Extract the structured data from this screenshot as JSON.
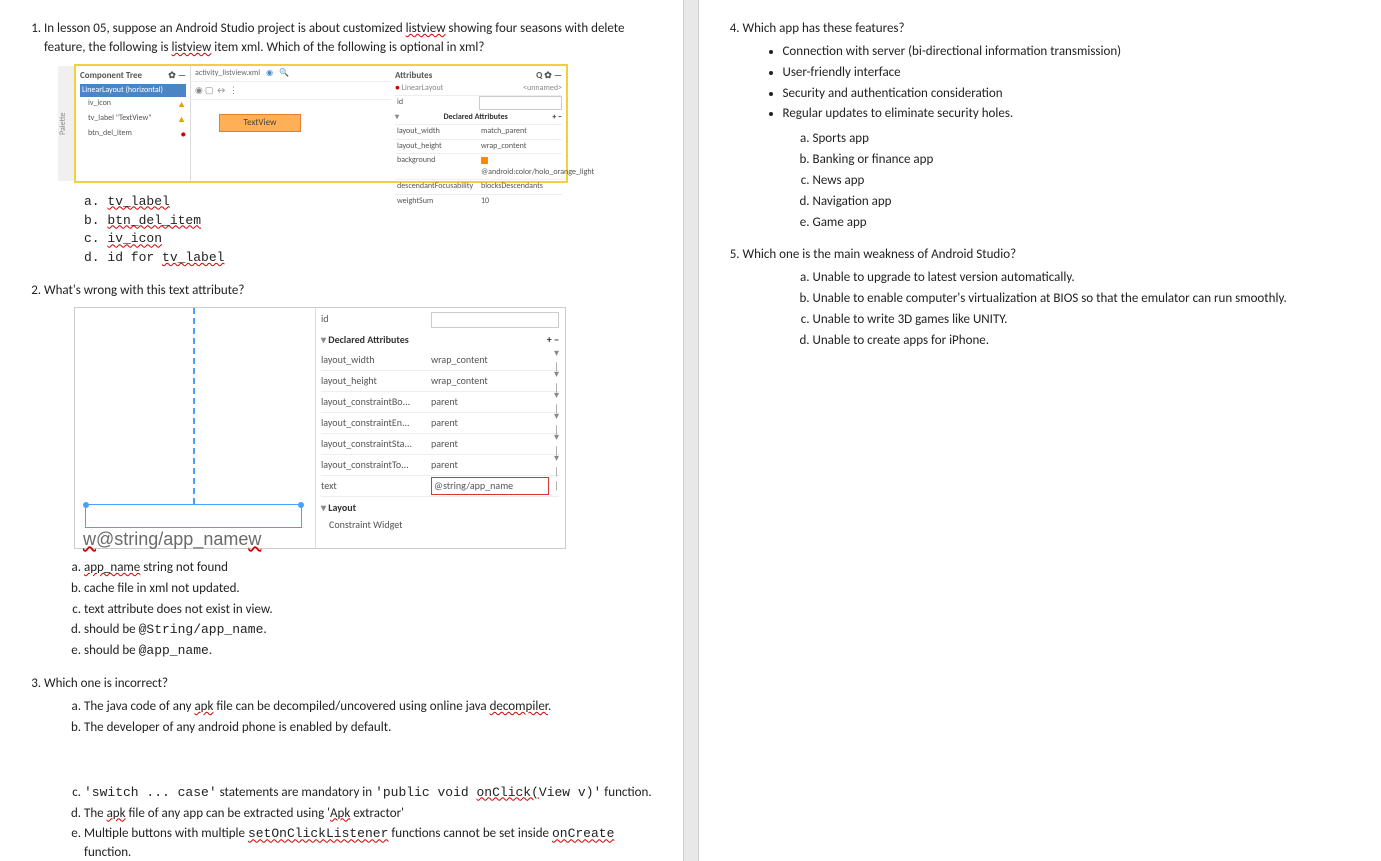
{
  "q1": {
    "text_a": "In lesson 05, suppose an Android Studio project is about customized ",
    "listview": "listview",
    "text_b": " showing four seasons with delete feature, the following is ",
    "text_c": " item xml. Which of the following is optional in xml?",
    "options": {
      "a": "tv_label",
      "b": "btn_del_item",
      "c": "iv_icon",
      "d_pre": "id for ",
      "d_name": "tv_label"
    },
    "shot": {
      "palette": "Palette",
      "tree_header": "Component Tree",
      "tree_gear": "✿ —",
      "linear": "LinearLayout (horizontal)",
      "iv": "iv_icon",
      "tvl": "tv_label \"TextView\"",
      "btn": "btn_del_item",
      "tab": "activity_listview.xml",
      "toolbar": "◉ ▢ ↔ ⋮",
      "textview": "TextView",
      "attr_hdr": "Attributes",
      "attr_icons": "Q ✿ —",
      "ll2": "LinearLayout",
      "unnamed": "<unnamed>",
      "id": "id",
      "decl": "Declared Attributes",
      "pm": "+ −",
      "rows": [
        {
          "k": "layout_width",
          "v": "match_parent"
        },
        {
          "k": "layout_height",
          "v": "wrap_content"
        },
        {
          "k": "background",
          "v": "@android:color/holo_orange_light"
        },
        {
          "k": "descendantFocusability",
          "v": "blocksDescendants"
        },
        {
          "k": "weightSum",
          "v": "10"
        }
      ]
    }
  },
  "q2": {
    "text": "What's wrong with this text attribute?",
    "options": {
      "a_pre": "app_name",
      "a_post": " string not found",
      "b": "cache file in xml not updated.",
      "c": "text attribute does not exist in view.",
      "d_pre": "should be ",
      "d_code": "@String/app_name",
      "e_pre": "should be ",
      "e_code": "@app_name"
    },
    "shot": {
      "preview_text": "@string/app_name",
      "id": "id",
      "decl": "Declared Attributes",
      "pm": "+ −",
      "rows": [
        {
          "k": "layout_width",
          "v": "wrap_content"
        },
        {
          "k": "layout_height",
          "v": "wrap_content"
        },
        {
          "k": "layout_constraintBo...",
          "v": "parent"
        },
        {
          "k": "layout_constraintEn...",
          "v": "parent"
        },
        {
          "k": "layout_constraintSta...",
          "v": "parent"
        },
        {
          "k": "layout_constraintTo...",
          "v": "parent"
        },
        {
          "k": "text",
          "v": "@string/app_name"
        }
      ],
      "layout": "Layout",
      "cw": "Constraint Widget"
    }
  },
  "q3": {
    "text": "Which one is incorrect?",
    "a_1": "The java code of any ",
    "a_apk": "apk",
    "a_2": " file can be decompiled/uncovered using online java ",
    "a_dec": "decompiler",
    "a_3": ".",
    "b": "The developer of any android phone is enabled by default.",
    "c_1": "'switch ... case'",
    "c_2": " statements are mandatory in ",
    "c_3": "'public void ",
    "c_on": "onClick(",
    "c_4": "View v)'",
    "c_5": " function.",
    "d_1": "The ",
    "d_apk": "apk",
    "d_2": " file of any app can be extracted using '",
    "d_apk2": "Apk",
    "d_3": " extractor'",
    "e_1": "Multiple buttons with multiple ",
    "e_set": "setOnClickListener",
    "e_2": " functions cannot be set inside ",
    "e_oc": "onCreate",
    "e_3": " function."
  },
  "q4": {
    "text": "Which app has these features?",
    "bullets": [
      "Connection with server (bi-directional information transmission)",
      "User-friendly interface",
      "Security and authentication consideration",
      "Regular updates to eliminate security holes."
    ],
    "options": [
      "Sports app",
      "Banking or finance app",
      "News app",
      "Navigation app",
      "Game app"
    ]
  },
  "q5": {
    "text": "Which one is the main weakness of Android Studio?",
    "options": [
      "Unable to upgrade to latest version automatically.",
      "Unable to enable computer's virtualization at BIOS so that the emulator can run smoothly.",
      "Unable to write 3D games like UNITY.",
      "Unable to create apps for iPhone."
    ]
  }
}
